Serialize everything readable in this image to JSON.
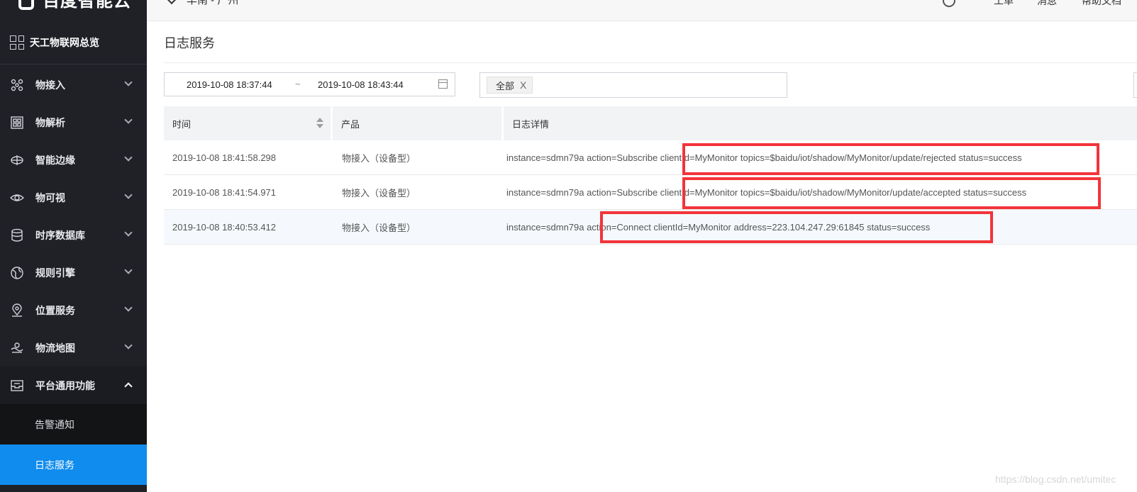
{
  "sidebar": {
    "brand": "百度智能云",
    "overview_label": "天工物联网总览",
    "items": [
      {
        "label": "物接入",
        "icon": "device-access-icon"
      },
      {
        "label": "物解析",
        "icon": "parse-icon"
      },
      {
        "label": "智能边缘",
        "icon": "edge-icon"
      },
      {
        "label": "物可视",
        "icon": "eye-icon"
      },
      {
        "label": "时序数据库",
        "icon": "database-icon"
      },
      {
        "label": "规则引擎",
        "icon": "globe-icon"
      },
      {
        "label": "位置服务",
        "icon": "location-icon"
      },
      {
        "label": "物流地图",
        "icon": "map-icon"
      },
      {
        "label": "平台通用功能",
        "icon": "inbox-icon"
      }
    ],
    "sub_items": [
      {
        "label": "告警通知"
      },
      {
        "label": "日志服务"
      }
    ]
  },
  "topbar": {
    "region": "华南 - 广州",
    "links": [
      "工单",
      "消息",
      "帮助文档"
    ]
  },
  "page": {
    "title": "日志服务",
    "date_start": "2019-10-08 18:37:44",
    "date_sep": "~",
    "date_end": "2019-10-08 18:43:44",
    "filter_tag": "全部",
    "filter_tag_close": "X"
  },
  "table": {
    "headers": [
      "时间",
      "产品",
      "日志详情"
    ],
    "rows": [
      {
        "time": "2019-10-08 18:41:58.298",
        "product": "物接入（设备型）",
        "detail": "instance=sdmn79a action=Subscribe clientId=MyMonitor topics=$baidu/iot/shadow/MyMonitor/update/rejected status=success"
      },
      {
        "time": "2019-10-08 18:41:54.971",
        "product": "物接入（设备型）",
        "detail": "instance=sdmn79a action=Subscribe clientId=MyMonitor topics=$baidu/iot/shadow/MyMonitor/update/accepted status=success"
      },
      {
        "time": "2019-10-08 18:40:53.412",
        "product": "物接入（设备型）",
        "detail": "instance=sdmn79a action=Connect clientId=MyMonitor address=223.104.247.29:61845 status=success"
      }
    ]
  },
  "watermark": "https://blog.csdn.net/umitec",
  "colors": {
    "sidebar_bg": "#1f2127",
    "active_item": "#108cee",
    "annotation": "#f2343a"
  }
}
